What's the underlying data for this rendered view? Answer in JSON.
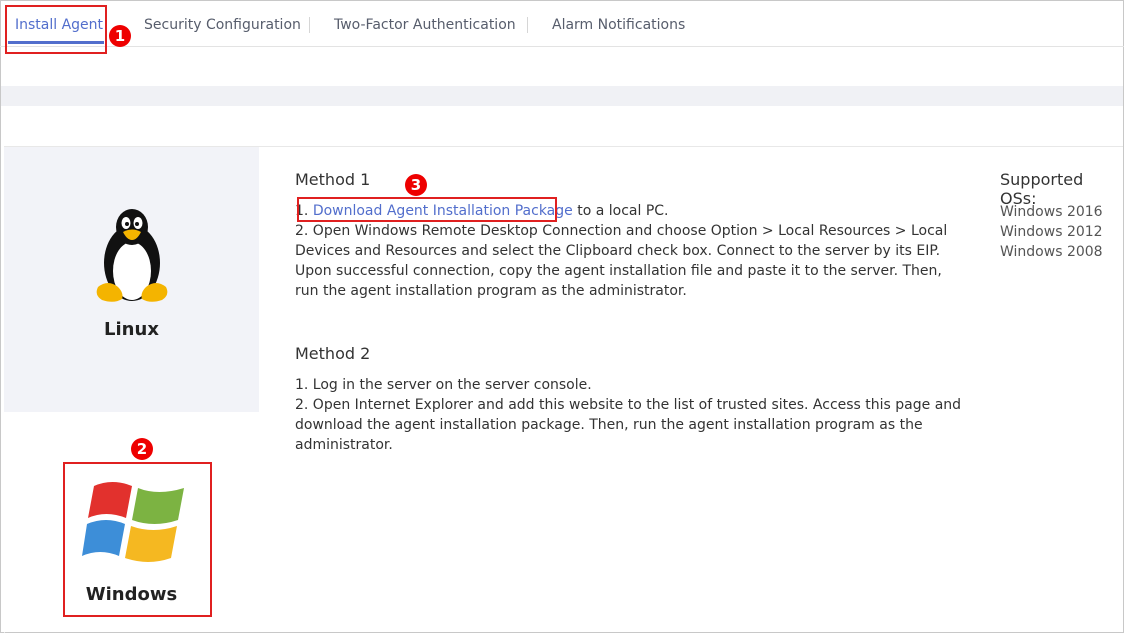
{
  "tabs": [
    {
      "label": "Install Agent",
      "active": true
    },
    {
      "label": "Security Configuration"
    },
    {
      "label": "Two-Factor Authentication"
    },
    {
      "label": "Alarm Notifications"
    }
  ],
  "os_cards": [
    {
      "label": "Linux",
      "icon": "linux-penguin-icon"
    },
    {
      "label": "Windows",
      "icon": "windows-logo-icon",
      "selected": true
    }
  ],
  "method1": {
    "title": "Method 1",
    "step1_prefix": "1. ",
    "link": "Download Agent Installation Package",
    "step1_suffix": " to a local PC.",
    "step2": "2. Open Windows Remote Desktop Connection and choose Option > Local Resources > Local Devices and Resources and select the Clipboard check box. Connect to the server by its EIP. Upon successful connection, copy the agent installation file and paste it to the server. Then, run the agent installation program as the administrator."
  },
  "method2": {
    "title": "Method 2",
    "step1": "1. Log in the server on the server console.",
    "step2": "2. Open Internet Explorer and add this website to the list of trusted sites. Access this page and download the agent installation package. Then, run the agent installation program as the administrator."
  },
  "supported": {
    "title": "Supported OSs:",
    "items": [
      "Windows 2016",
      "Windows 2012",
      "Windows 2008"
    ]
  },
  "annotations": [
    "1",
    "2",
    "3"
  ],
  "colors": {
    "accent": "#526ecc",
    "annotation": "#e02020"
  }
}
